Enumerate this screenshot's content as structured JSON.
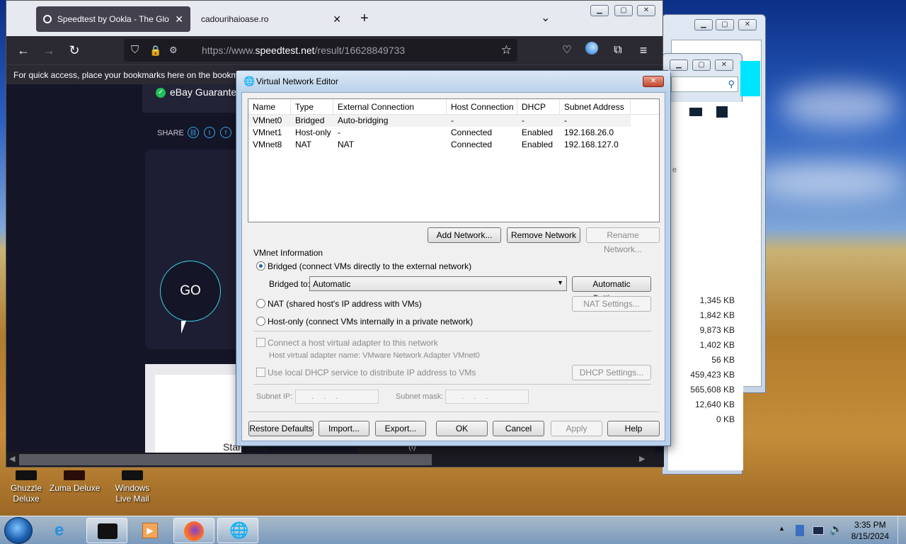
{
  "firefox": {
    "tabs": [
      {
        "label": "Speedtest by Ookla - The Global",
        "active": true
      },
      {
        "label": "cadourihaioase.ro",
        "active": false
      }
    ],
    "url_prefix": "https://www.",
    "url_domain": "speedtest.net",
    "url_path": "/result/16628849733",
    "bookmarks_message": "For quick access, place your bookmarks here on the bookm",
    "page": {
      "ebay_text": "eBay Guarante",
      "share_label": "SHARE",
      "go_label": "GO",
      "start_now": "Start Now",
      "info_glyph": "(i)"
    }
  },
  "explorer_sizes": [
    "1,345 KB",
    "1,842 KB",
    "9,873 KB",
    "1,402 KB",
    "56 KB",
    "459,423 KB",
    "565,608 KB",
    "12,640 KB",
    "0 KB"
  ],
  "explorer_col_fragment": "e",
  "vne": {
    "title": "Virtual Network Editor",
    "columns": [
      "Name",
      "Type",
      "External Connection",
      "Host Connection",
      "DHCP",
      "Subnet Address"
    ],
    "rows": [
      [
        "VMnet0",
        "Bridged",
        "Auto-bridging",
        "-",
        "-",
        "-"
      ],
      [
        "VMnet1",
        "Host-only",
        "-",
        "Connected",
        "Enabled",
        "192.168.26.0"
      ],
      [
        "VMnet8",
        "NAT",
        "NAT",
        "Connected",
        "Enabled",
        "192.168.127.0"
      ]
    ],
    "add_network": "Add Network...",
    "remove_network": "Remove Network",
    "rename_network": "Rename Network...",
    "vmnet_info": "VMnet Information",
    "bridged_radio": "Bridged (connect VMs directly to the external network)",
    "bridged_to_label": "Bridged to:",
    "bridged_to_value": "Automatic",
    "automatic_settings": "Automatic Settings...",
    "nat_radio": "NAT (shared host's IP address with VMs)",
    "nat_settings": "NAT Settings...",
    "hostonly_radio": "Host-only (connect VMs internally in a private network)",
    "connect_adapter": "Connect a host virtual adapter to this network",
    "adapter_name": "Host virtual adapter name: VMware Network Adapter VMnet0",
    "use_dhcp": "Use local DHCP service to distribute IP address to VMs",
    "dhcp_settings": "DHCP Settings...",
    "subnet_ip_label": "Subnet IP:",
    "subnet_mask_label": "Subnet mask:",
    "ip_dots": "...",
    "restore_defaults": "Restore Defaults",
    "import": "Import...",
    "export": "Export...",
    "ok": "OK",
    "cancel": "Cancel",
    "apply": "Apply",
    "help": "Help"
  },
  "desktop_icons": [
    {
      "line1": "Ghuzzle",
      "line2": "Deluxe"
    },
    {
      "line1": "Zuma Deluxe",
      "line2": ""
    },
    {
      "line1": "Windows",
      "line2": "Live Mail"
    }
  ],
  "clock": {
    "time": "3:35 PM",
    "date": "8/15/2024"
  },
  "colors": {
    "firefox_dark": "#1c1b22",
    "vne_frame": "#b9d1ea",
    "dialog_bg": "#f0f0f0",
    "go_ring": "#3ad1e6"
  }
}
